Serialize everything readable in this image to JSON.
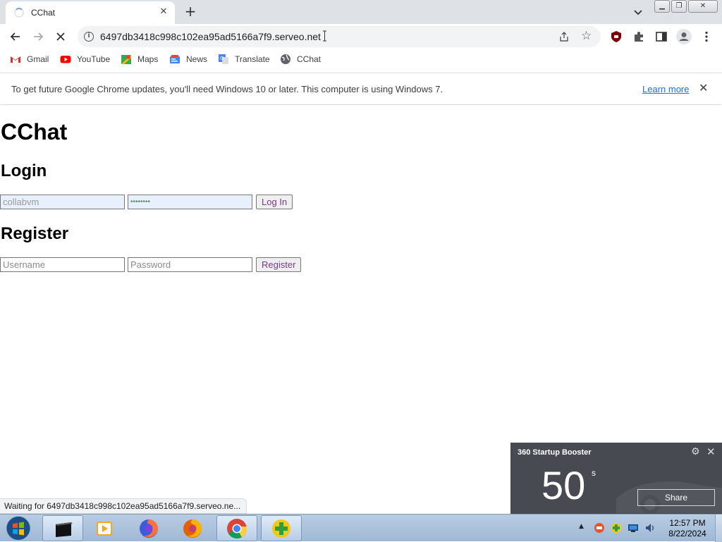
{
  "browser": {
    "tab": {
      "title": "CChat"
    },
    "address": {
      "url": "6497db3418c998c102ea95ad5166a7f9.serveo.net"
    },
    "bookmarks": [
      {
        "label": "Gmail"
      },
      {
        "label": "YouTube"
      },
      {
        "label": "Maps"
      },
      {
        "label": "News"
      },
      {
        "label": "Translate"
      },
      {
        "label": "CChat"
      }
    ],
    "infobar": {
      "message": "To get future Google Chrome updates, you'll need Windows 10 or later. This computer is using Windows 7.",
      "link": "Learn more"
    },
    "status_text": "Waiting for 6497db3418c998c102ea95ad5166a7f9.serveo.ne..."
  },
  "page": {
    "title": "CChat",
    "login": {
      "heading": "Login",
      "username_value": "collabvm",
      "password_value": "••••••••",
      "button": "Log In"
    },
    "register": {
      "heading": "Register",
      "username_placeholder": "Username",
      "password_placeholder": "Password",
      "button": "Register"
    }
  },
  "booster": {
    "title": "360 Startup Booster",
    "seconds": "50",
    "unit": "s",
    "share": "Share"
  },
  "taskbar": {
    "time": "12:57 PM",
    "date": "8/22/2024"
  }
}
